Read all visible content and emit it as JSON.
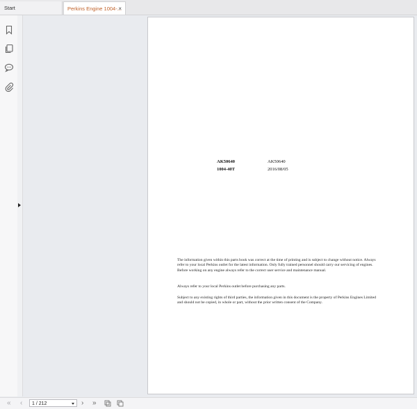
{
  "tabs": [
    {
      "label": "Start"
    },
    {
      "label": "Perkins Engine 1004-..."
    }
  ],
  "tab_close_glyph": "×",
  "sidebar": {
    "icons": [
      "bookmark-icon",
      "pages-icon",
      "comments-icon",
      "attachment-icon"
    ]
  },
  "document": {
    "meta": [
      {
        "key": "AK50640",
        "value": "AK50640"
      },
      {
        "key": "1004-40T",
        "value": "2016/08/05"
      }
    ],
    "paragraphs": [
      "The information given within this parts book was correct at the time of printing and is subject to change without notice. Always refer to your local Perkins outlet for the latest information. Only fully trained personnel should carry our servicing of engines. Before working on any engine always refer to the correct user service and maintenance manual.",
      "Always refer to your local Perkins outlet before purchasing any parts.",
      "Subject to any existing rights of third parties, the information given in this document is the property of Perkins Engines Limited and should not be copied, in whole or part, without the prior written consent of the Company."
    ]
  },
  "navigation": {
    "first_glyph": "«",
    "prev_glyph": "‹",
    "page_indicator": "1 / 212",
    "next_glyph": "›",
    "last_glyph": "»"
  },
  "colors": {
    "active_tab_text": "#c0622a",
    "background": "#e9ebef"
  }
}
